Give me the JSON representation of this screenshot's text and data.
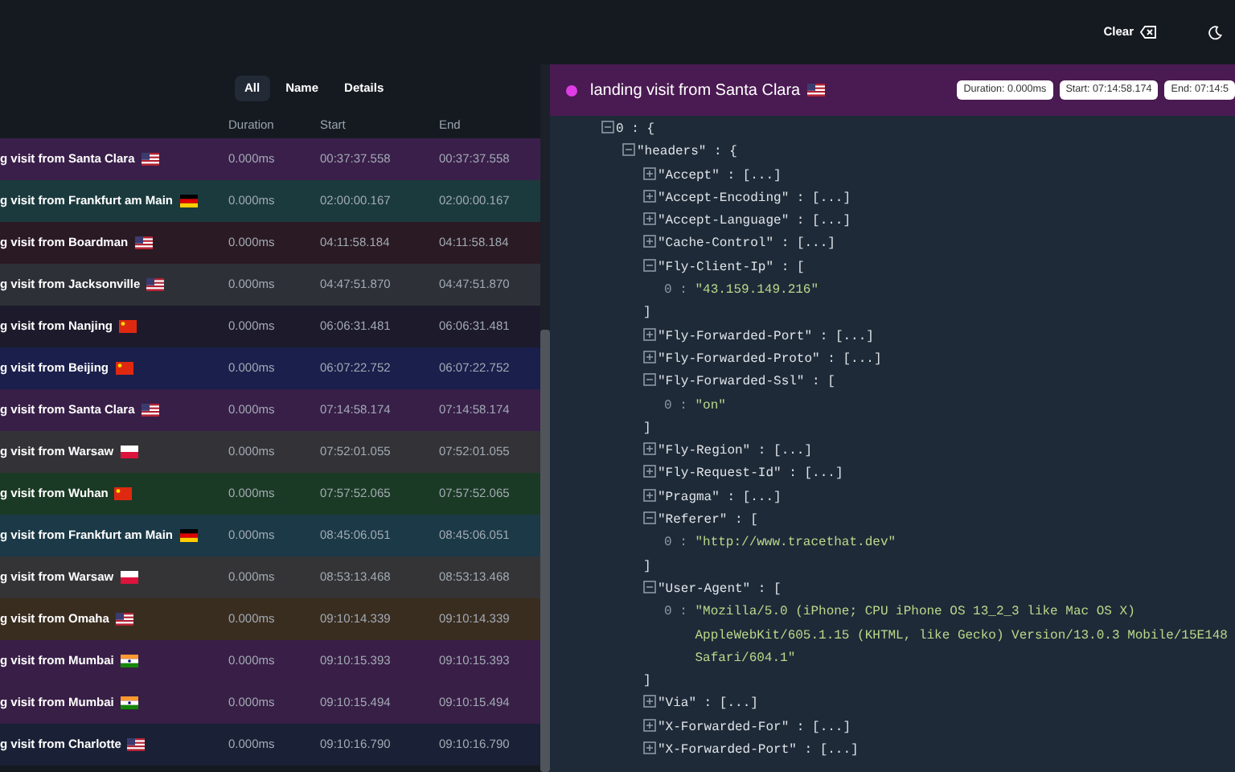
{
  "toolbar": {
    "clear_label": "Clear"
  },
  "tabs": [
    {
      "label": "All",
      "selected": true
    },
    {
      "label": "Name",
      "selected": false
    },
    {
      "label": "Details",
      "selected": false
    }
  ],
  "table": {
    "columns": [
      "Duration",
      "Start",
      "End"
    ],
    "rows": [
      {
        "name": "g visit from Santa Clara",
        "flag": {
          "kind": "us"
        },
        "duration": "0.000ms",
        "start": "00:37:37.558",
        "end": "00:37:37.558",
        "color": "#3a1f4a"
      },
      {
        "name": "g visit from Frankfurt am Main",
        "flag": {
          "kind": "de"
        },
        "duration": "0.000ms",
        "start": "02:00:00.167",
        "end": "02:00:00.167",
        "color": "#1b3a3e"
      },
      {
        "name": "g visit from Boardman",
        "flag": {
          "kind": "us"
        },
        "duration": "0.000ms",
        "start": "04:11:58.184",
        "end": "04:11:58.184",
        "color": "#2a1a24"
      },
      {
        "name": "g visit from Jacksonville",
        "flag": {
          "kind": "us"
        },
        "duration": "0.000ms",
        "start": "04:47:51.870",
        "end": "04:47:51.870",
        "color": "#2d3137"
      },
      {
        "name": "g visit from Nanjing",
        "flag": {
          "kind": "cn"
        },
        "duration": "0.000ms",
        "start": "06:06:31.481",
        "end": "06:06:31.481",
        "color": "#1d1a2b"
      },
      {
        "name": "g visit from Beijing",
        "flag": {
          "kind": "cn"
        },
        "duration": "0.000ms",
        "start": "06:07:22.752",
        "end": "06:07:22.752",
        "color": "#1a1f4c"
      },
      {
        "name": "g visit from Santa Clara",
        "flag": {
          "kind": "us"
        },
        "duration": "0.000ms",
        "start": "07:14:58.174",
        "end": "07:14:58.174",
        "color": "#381f48"
      },
      {
        "name": "g visit from Warsaw",
        "flag": {
          "kind": "pl"
        },
        "duration": "0.000ms",
        "start": "07:52:01.055",
        "end": "07:52:01.055",
        "color": "#333337"
      },
      {
        "name": "g visit from Wuhan",
        "flag": {
          "kind": "cn"
        },
        "duration": "0.000ms",
        "start": "07:57:52.065",
        "end": "07:57:52.065",
        "color": "#1b3a25"
      },
      {
        "name": "g visit from Frankfurt am Main",
        "flag": {
          "kind": "de"
        },
        "duration": "0.000ms",
        "start": "08:45:06.051",
        "end": "08:45:06.051",
        "color": "#1b3947"
      },
      {
        "name": "g visit from Warsaw",
        "flag": {
          "kind": "pl"
        },
        "duration": "0.000ms",
        "start": "08:53:13.468",
        "end": "08:53:13.468",
        "color": "#343436"
      },
      {
        "name": "g visit from Omaha",
        "flag": {
          "kind": "us"
        },
        "duration": "0.000ms",
        "start": "09:10:14.339",
        "end": "09:10:14.339",
        "color": "#392d20"
      },
      {
        "name": "g visit from Mumbai",
        "flag": {
          "kind": "in"
        },
        "duration": "0.000ms",
        "start": "09:10:15.393",
        "end": "09:10:15.393",
        "color": "#391f47"
      },
      {
        "name": "g visit from Mumbai",
        "flag": {
          "kind": "in"
        },
        "duration": "0.000ms",
        "start": "09:10:15.494",
        "end": "09:10:15.494",
        "color": "#381f46"
      },
      {
        "name": "g visit from Charlotte",
        "flag": {
          "kind": "us"
        },
        "duration": "0.000ms",
        "start": "09:10:16.790",
        "end": "09:10:16.790",
        "color": "#1a2136"
      }
    ]
  },
  "detail": {
    "title": "landing visit from Santa Clara",
    "flag": {
      "kind": "us"
    },
    "status": {
      "color": "#e03ce6"
    },
    "badges": [
      "Duration: 0.000ms",
      "Start: 07:14:58.174",
      "End: 07:14:5"
    ],
    "tree": [
      {
        "key": "0 :",
        "open": "{",
        "expanded": true,
        "children": [
          {
            "key": "\"headers\" :",
            "open": "{",
            "expanded": true,
            "children": [
              {
                "key": "\"Accept\" :",
                "summary": "[...]",
                "expanded": false
              },
              {
                "key": "\"Accept-Encoding\" :",
                "summary": "[...]",
                "expanded": false
              },
              {
                "key": "\"Accept-Language\" :",
                "summary": "[...]",
                "expanded": false
              },
              {
                "key": "\"Cache-Control\" :",
                "summary": "[...]",
                "expanded": false
              },
              {
                "key": "\"Fly-Client-Ip\" :",
                "open": "[",
                "close": "]",
                "expanded": true,
                "children": [
                  {
                    "key": "0 :",
                    "value": "\"43.159.149.216\""
                  }
                ]
              },
              {
                "key": "\"Fly-Forwarded-Port\" :",
                "summary": "[...]",
                "expanded": false
              },
              {
                "key": "\"Fly-Forwarded-Proto\" :",
                "summary": "[...]",
                "expanded": false
              },
              {
                "key": "\"Fly-Forwarded-Ssl\" :",
                "open": "[",
                "close": "]",
                "expanded": true,
                "children": [
                  {
                    "key": "0 :",
                    "value": "\"on\""
                  }
                ]
              },
              {
                "key": "\"Fly-Region\" :",
                "summary": "[...]",
                "expanded": false
              },
              {
                "key": "\"Fly-Request-Id\" :",
                "summary": "[...]",
                "expanded": false
              },
              {
                "key": "\"Pragma\" :",
                "summary": "[...]",
                "expanded": false
              },
              {
                "key": "\"Referer\" :",
                "open": "[",
                "close": "]",
                "expanded": true,
                "children": [
                  {
                    "key": "0 :",
                    "value": "\"http://www.tracethat.dev\""
                  }
                ]
              },
              {
                "key": "\"User-Agent\" :",
                "open": "[",
                "close": "]",
                "expanded": true,
                "children": [
                  {
                    "key": "0 :",
                    "value": "\"Mozilla/5.0 (iPhone; CPU iPhone OS 13_2_3 like Mac OS X) AppleWebKit/605.1.15 (KHTML, like Gecko) Version/13.0.3 Mobile/15E148 Safari/604.1\""
                  }
                ]
              },
              {
                "key": "\"Via\" :",
                "summary": "[...]",
                "expanded": false
              },
              {
                "key": "\"X-Forwarded-For\" :",
                "summary": "[...]",
                "expanded": false
              },
              {
                "key": "\"X-Forwarded-Port\" :",
                "summary": "[...]",
                "expanded": false
              }
            ]
          }
        ]
      }
    ]
  }
}
